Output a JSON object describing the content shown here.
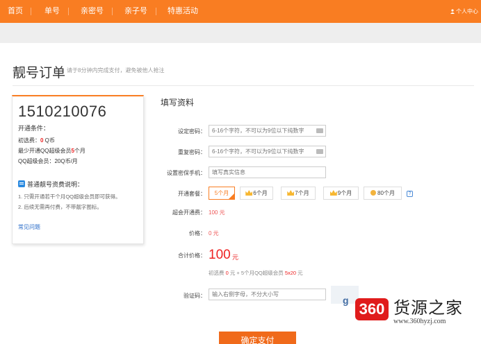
{
  "nav": {
    "items": [
      "首页",
      "单号",
      "亲密号",
      "亲子号",
      "特惠活动"
    ],
    "user_label": "个人中心"
  },
  "page": {
    "title": "靓号订单",
    "subtitle": "请于8分钟内完成支付，避免被他人抢注"
  },
  "panel": {
    "number": "1510210076",
    "condition_title": "开通条件：",
    "select_fee_prefix": "初选费：",
    "select_fee_value": "0",
    "select_fee_unit": " Q币",
    "min_member_prefix": "最少开通QQ超级会员",
    "min_member_value": "5",
    "min_member_unit": "个月",
    "member_price": "QQ超级会员：20Q币/月",
    "explain_title": "普通靓号资费说明：",
    "rules": [
      "1. 只需开通若干个月QQ超级会员即可获得。",
      "2. 后续无需再付费，不带靓字图标。"
    ],
    "faq": "常见问题"
  },
  "form": {
    "title": "填写资料",
    "password_label": "设定密码：",
    "password_placeholder": "6-16个字符，不可以为9位以下纯数字",
    "confirm_label": "重复密码：",
    "confirm_placeholder": "6-16个字符，不可以为9位以下纯数字",
    "phone_label": "设置密保手机：",
    "phone_placeholder": "填写真实信息",
    "plan_label": "开通套餐：",
    "plans": [
      "5个月",
      "6个月",
      "7个月",
      "9个月",
      "80个月"
    ],
    "member_fee_label": "超会开通费：",
    "member_fee_value": "100 元",
    "price_label": "价格：",
    "price_value": "0 元",
    "total_label": "合计价格：",
    "total_value": "100",
    "total_unit": "元",
    "breakdown_prefix": "初选费 ",
    "breakdown_fee": "0",
    "breakdown_mid": " 元 + 5个月QQ超级会员 ",
    "breakdown_calc": "5x20",
    "breakdown_suffix": " 元",
    "captcha_label": "验证码：",
    "captcha_placeholder": "输入右侧字母，不分大小写",
    "submit_label": "确定支付",
    "help_glyph": "?",
    "captcha_text": "g"
  },
  "watermark": {
    "badge": "360",
    "name": "货源之家",
    "url": "www.360hyzj.com"
  },
  "colors": {
    "brand": "#f97d22",
    "price": "#e22222",
    "link": "#2a6cc8"
  }
}
